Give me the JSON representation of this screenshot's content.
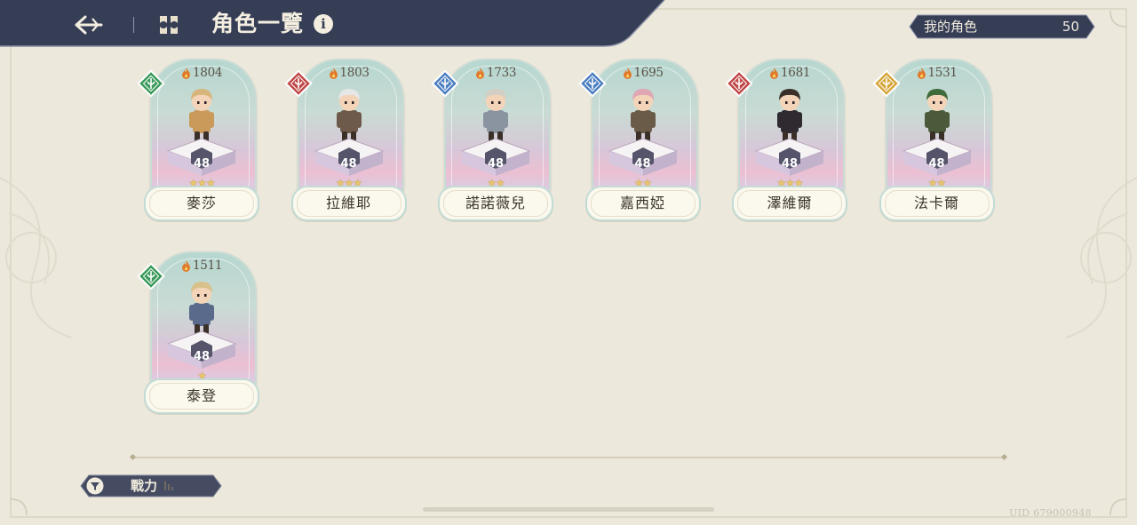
{
  "header": {
    "title": "角色一覽",
    "info_glyph": "i",
    "back_icon": "back-arrow-icon",
    "category_icon": "character-category-icon"
  },
  "counter": {
    "label": "我的角色",
    "value": "50"
  },
  "characters": [
    {
      "name": "麥莎",
      "power": "1804",
      "level": "48",
      "stars": 3,
      "element": "nature",
      "element_color": "#3a9a5a",
      "sprite_color": "#c99a5a",
      "hair_color": "#d8b57a"
    },
    {
      "name": "拉維耶",
      "power": "1803",
      "level": "48",
      "stars": 3,
      "element": "fire",
      "element_color": "#c04848",
      "sprite_color": "#6e5a4a",
      "hair_color": "#e6e6e6"
    },
    {
      "name": "諾諾薇兒",
      "power": "1733",
      "level": "48",
      "stars": 2,
      "element": "water",
      "element_color": "#4c7fc0",
      "sprite_color": "#8a93a0",
      "hair_color": "#d4cfc4"
    },
    {
      "name": "嘉西婭",
      "power": "1695",
      "level": "48",
      "stars": 2,
      "element": "water",
      "element_color": "#4c7fc0",
      "sprite_color": "#6a5a48",
      "hair_color": "#e0a6b4"
    },
    {
      "name": "澤維爾",
      "power": "1681",
      "level": "48",
      "stars": 3,
      "element": "fire",
      "element_color": "#c04848",
      "sprite_color": "#2e2a30",
      "hair_color": "#3a302a"
    },
    {
      "name": "法卡爾",
      "power": "1531",
      "level": "48",
      "stars": 2,
      "element": "light",
      "element_color": "#d6a63a",
      "sprite_color": "#4a5a3a",
      "hair_color": "#3f6a3a"
    },
    {
      "name": "泰登",
      "power": "1511",
      "level": "48",
      "stars": 1,
      "element": "nature",
      "element_color": "#3a9a5a",
      "sprite_color": "#5a6a8a",
      "hair_color": "#d8c08a"
    }
  ],
  "filter": {
    "label": "戰力",
    "icon": "filter-icon",
    "sort_icon": "sort-descending-icon"
  },
  "uid": "UID 679000948",
  "colors": {
    "navy": "#363e56",
    "parchment": "#ede8dc",
    "gold": "#e8c56a"
  }
}
